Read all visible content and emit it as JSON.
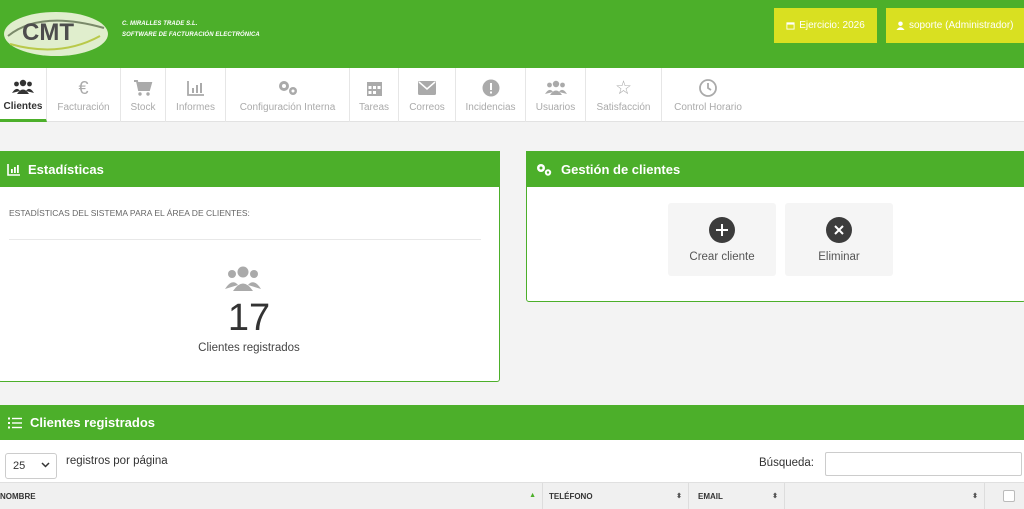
{
  "header": {
    "company_line1": "C. MIRALLES TRADE S.L.",
    "company_line2": "SOFTWARE DE FACTURACIÓN ELECTRÓNICA",
    "logo_text": "CMT",
    "ejercicio_label": "Ejercicio: 2026",
    "user_label": "soporte (Administrador)"
  },
  "nav": [
    {
      "label": "Clientes",
      "icon": "users-icon",
      "active": true
    },
    {
      "label": "Facturación",
      "icon": "euro-icon"
    },
    {
      "label": "Stock",
      "icon": "cart-icon"
    },
    {
      "label": "Informes",
      "icon": "chart-icon"
    },
    {
      "label": "Configuración Interna",
      "icon": "gears-icon"
    },
    {
      "label": "Tareas",
      "icon": "calendar-icon"
    },
    {
      "label": "Correos",
      "icon": "envelope-icon"
    },
    {
      "label": "Incidencias",
      "icon": "alert-icon"
    },
    {
      "label": "Usuarios",
      "icon": "users-icon"
    },
    {
      "label": "Satisfacción",
      "icon": "star-icon"
    },
    {
      "label": "Control Horario",
      "icon": "clock-icon"
    }
  ],
  "stats": {
    "title": "Estadísticas",
    "subtitle": "ESTADÍSTICAS DEL SISTEMA PARA EL ÁREA DE CLIENTES:",
    "count": "17",
    "count_label": "Clientes registrados"
  },
  "gestion": {
    "title": "Gestión de clientes",
    "create_label": "Crear cliente",
    "delete_label": "Eliminar"
  },
  "list": {
    "title": "Clientes registrados",
    "page_length": "25",
    "page_length_suffix": "registros por página",
    "search_label": "Búsqueda:",
    "search_value": "",
    "columns": [
      "NOMBRE",
      "TELÉFONO",
      "EMAIL",
      ""
    ]
  },
  "colors": {
    "brand_green": "#4caf2a",
    "header_button": "#d9e021"
  }
}
